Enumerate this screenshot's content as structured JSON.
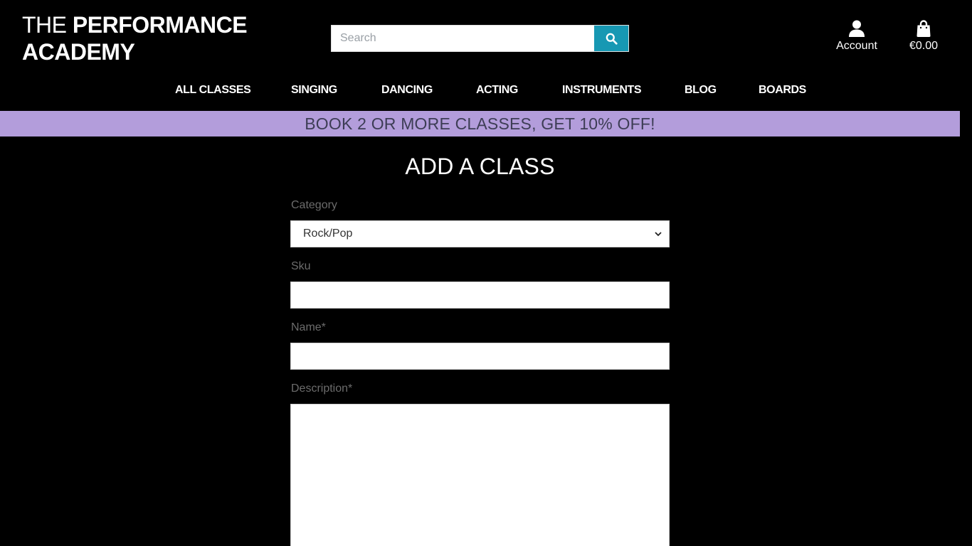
{
  "header": {
    "logo_light": "THE",
    "logo_bold_1": "PERFORMANCE",
    "logo_bold_2": "ACADEMY",
    "search_placeholder": "Search",
    "account_label": "Account",
    "bag_total": "€0.00",
    "icons": {
      "search": "search-icon",
      "account": "user-icon",
      "bag": "shopping-bag-icon"
    },
    "colors": {
      "search_button": "#1798b3"
    }
  },
  "nav": {
    "items": [
      "ALL CLASSES",
      "SINGING",
      "DANCING",
      "ACTING",
      "INSTRUMENTS",
      "BLOG",
      "BOARDS"
    ]
  },
  "promo": {
    "text": "BOOK 2 OR MORE CLASSES, GET 10% OFF!",
    "color": "#b39ddb"
  },
  "form": {
    "title": "ADD A CLASS",
    "category_label": "Category",
    "category_value": "Rock/Pop",
    "sku_label": "Sku",
    "sku_value": "",
    "name_label": "Name*",
    "name_value": "",
    "description_label": "Description*",
    "description_value": ""
  }
}
